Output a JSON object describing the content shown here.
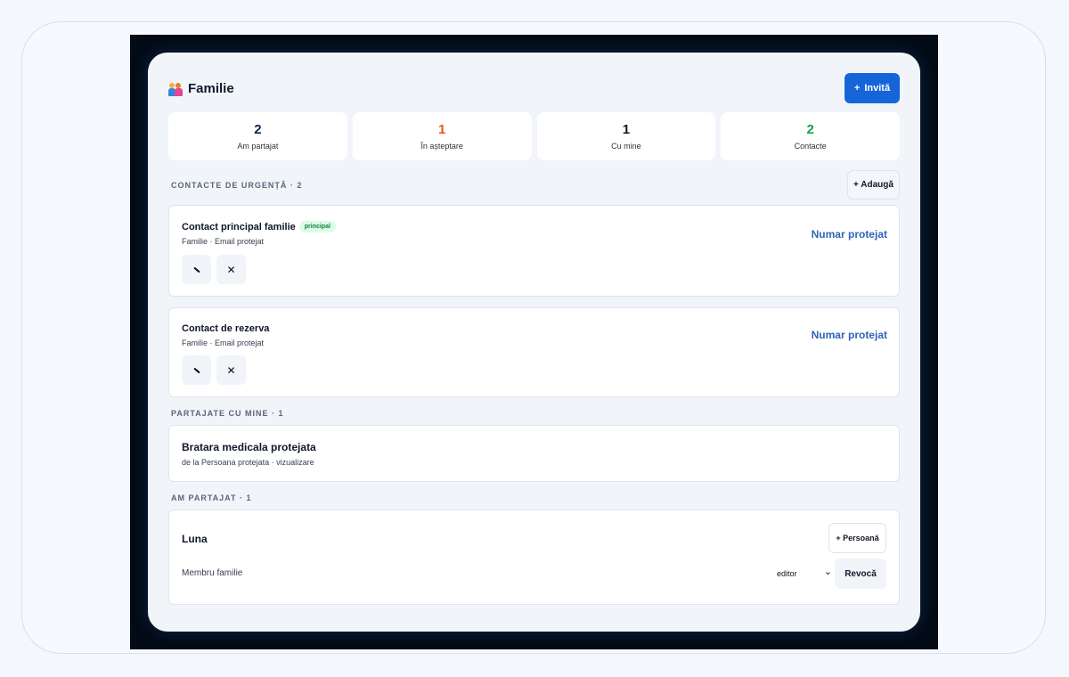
{
  "header": {
    "title": "Familie",
    "invite_label": "Invită",
    "invite_icon": "+"
  },
  "stats": [
    {
      "value": "2",
      "label": "Am partajat",
      "color": "#0f2447"
    },
    {
      "value": "1",
      "label": "În așteptare",
      "color": "#e8590c"
    },
    {
      "value": "1",
      "label": "Cu mine",
      "color": "#0f172a"
    },
    {
      "value": "2",
      "label": "Contacte",
      "color": "#16a34a"
    }
  ],
  "emergency": {
    "section_label": "CONTACTE DE URGENȚĂ · 2",
    "add_label": "+ Adaugă",
    "contacts": [
      {
        "name": "Contact principal familie",
        "badge": "principal",
        "sub": "Familie · Email protejat",
        "phone": "Numar protejat"
      },
      {
        "name": "Contact de rezerva",
        "badge": "",
        "sub": "Familie · Email protejat",
        "phone": "Numar protejat"
      }
    ]
  },
  "shared_with_me": {
    "section_label": "PARTAJATE CU MINE · 1",
    "items": [
      {
        "name": "Bratara medicala protejata",
        "sub": "de la Persoana protejata · vizualizare"
      }
    ]
  },
  "i_shared": {
    "section_label": "AM PARTAJAT · 1",
    "items": [
      {
        "name": "Luna",
        "person_label": "+ Persoană",
        "member": "Membru familie",
        "role": "editor",
        "revoke_label": "Revocă"
      }
    ]
  },
  "icons": {
    "close": "✕",
    "chevron": "⌄"
  }
}
